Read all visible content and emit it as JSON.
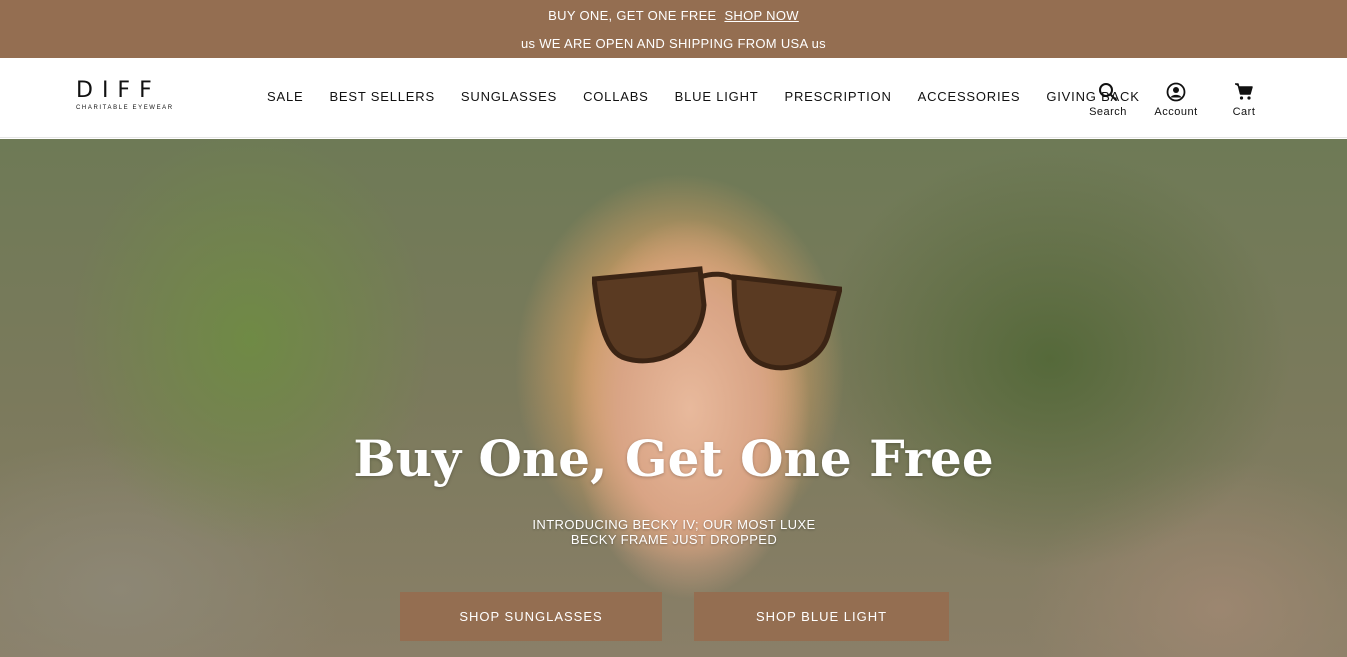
{
  "announcement": {
    "promo_text": "BUY ONE, GET ONE FREE",
    "promo_link": "SHOP NOW",
    "shipping_text": "us WE ARE OPEN AND SHIPPING FROM USA us"
  },
  "brand": {
    "name": "DIFF",
    "tagline": "CHARITABLE EYEWEAR"
  },
  "nav": [
    {
      "label": "SALE"
    },
    {
      "label": "BEST SELLERS"
    },
    {
      "label": "SUNGLASSES"
    },
    {
      "label": "COLLABS"
    },
    {
      "label": "BLUE LIGHT"
    },
    {
      "label": "PRESCRIPTION"
    },
    {
      "label": "ACCESSORIES"
    },
    {
      "label": "GIVING BACK"
    }
  ],
  "tools": {
    "search_label": "Search",
    "account_label": "Account",
    "cart_label": "Cart"
  },
  "hero": {
    "title": "Buy One, Get One Free",
    "subtitle": "INTRODUCING BECKY IV; OUR MOST LUXE BECKY FRAME JUST DROPPED",
    "button_sunglasses": "SHOP SUNGLASSES",
    "button_blue_light": "SHOP BLUE LIGHT"
  },
  "colors": {
    "brand_brown": "#946e51",
    "text": "#111111",
    "white": "#ffffff"
  }
}
